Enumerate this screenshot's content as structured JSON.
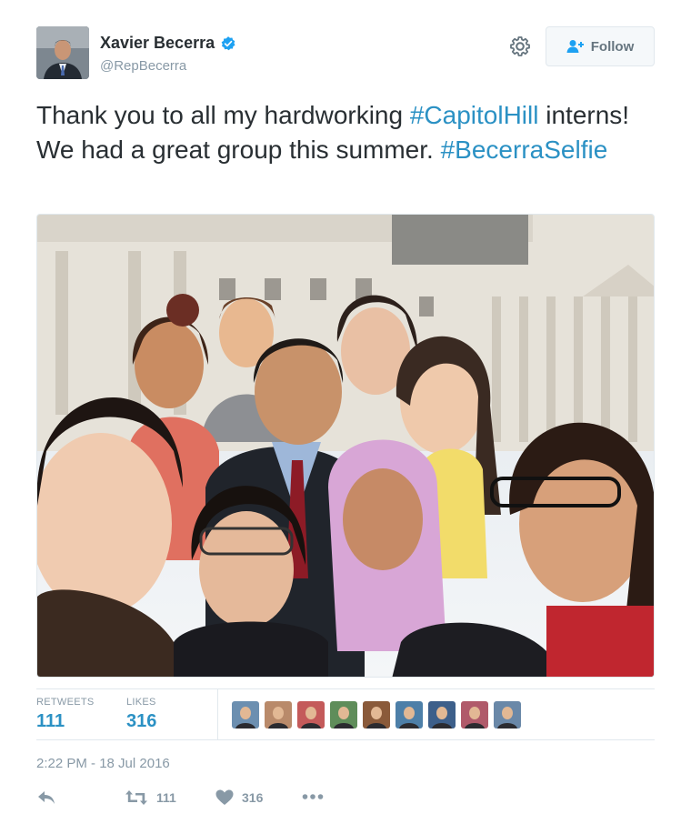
{
  "author": {
    "display_name": "Xavier Becerra",
    "handle": "@RepBecerra",
    "verified": true
  },
  "follow_button": {
    "label": "Follow",
    "icon": "add-user-icon"
  },
  "settings_icon": "gear-icon",
  "tweet": {
    "text_segments": [
      {
        "text": "Thank you to all my hardworking ",
        "type": "text"
      },
      {
        "text": "#CapitolHill",
        "type": "hashtag"
      },
      {
        "text": " interns! We had a great group this summer. ",
        "type": "text"
      },
      {
        "text": "#BecerraSelfie",
        "type": "hashtag"
      }
    ],
    "photo": {
      "subject": "group-selfie-in-front-of-capitol"
    }
  },
  "stats": {
    "retweets": {
      "label": "RETWEETS",
      "value": "111"
    },
    "likes": {
      "label": "LIKES",
      "value": "316"
    }
  },
  "likers": [
    {
      "icon": "liker-avatar-1",
      "color": "#6c8fb0"
    },
    {
      "icon": "liker-avatar-2",
      "color": "#b98a6a"
    },
    {
      "icon": "liker-avatar-3",
      "color": "#c45a5a"
    },
    {
      "icon": "liker-avatar-4",
      "color": "#5f8d5a"
    },
    {
      "icon": "liker-avatar-5",
      "color": "#8a5a3a"
    },
    {
      "icon": "liker-avatar-6",
      "color": "#4d7fa8"
    },
    {
      "icon": "liker-avatar-7",
      "color": "#3d5f8a"
    },
    {
      "icon": "liker-avatar-8",
      "color": "#b05a6a"
    },
    {
      "icon": "liker-avatar-9",
      "color": "#6a88a8"
    }
  ],
  "timestamp": "2:22 PM - 18 Jul 2016",
  "actions": {
    "reply": {
      "icon": "reply-icon"
    },
    "retweet": {
      "icon": "retweet-icon",
      "count": "111"
    },
    "like": {
      "icon": "heart-icon",
      "count": "316"
    },
    "more": {
      "icon": "more-icon"
    }
  },
  "colors": {
    "link": "#2b91c4",
    "muted": "#8899a6",
    "verified": "#1da1f2",
    "border": "#e1e8ed"
  }
}
